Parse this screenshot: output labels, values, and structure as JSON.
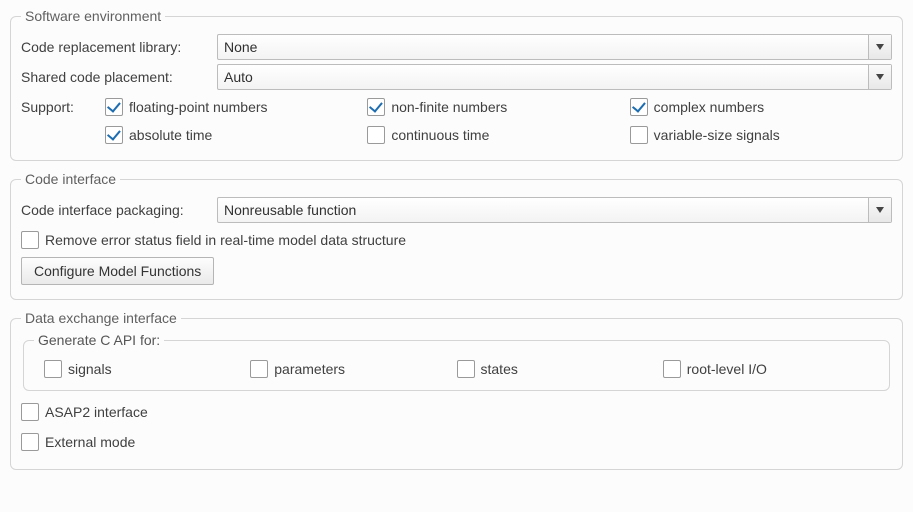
{
  "software_env": {
    "title": "Software environment",
    "code_replacement_label": "Code replacement library:",
    "code_replacement_value": "None",
    "shared_code_label": "Shared code placement:",
    "shared_code_value": "Auto",
    "support_label": "Support:",
    "support": {
      "row1": {
        "float": {
          "label": "floating-point numbers",
          "checked": true
        },
        "nonfin": {
          "label": "non-finite numbers",
          "checked": true
        },
        "complex": {
          "label": "complex numbers",
          "checked": true
        }
      },
      "row2": {
        "abstime": {
          "label": "absolute time",
          "checked": true
        },
        "cont": {
          "label": "continuous time",
          "checked": false
        },
        "varsize": {
          "label": "variable-size signals",
          "checked": false
        }
      }
    }
  },
  "code_interface": {
    "title": "Code interface",
    "packaging_label": "Code interface packaging:",
    "packaging_value": "Nonreusable function",
    "remove_err": {
      "label": "Remove error status field in real-time model data structure",
      "checked": false
    },
    "configure_btn": "Configure Model Functions"
  },
  "data_exchange": {
    "title": "Data exchange interface",
    "capi_title": "Generate C API for:",
    "capi": {
      "signals": {
        "label": "signals",
        "checked": false
      },
      "parameters": {
        "label": "parameters",
        "checked": false
      },
      "states": {
        "label": "states",
        "checked": false
      },
      "rootio": {
        "label": "root-level I/O",
        "checked": false
      }
    },
    "asap2": {
      "label": "ASAP2 interface",
      "checked": false
    },
    "external": {
      "label": "External mode",
      "checked": false
    }
  }
}
